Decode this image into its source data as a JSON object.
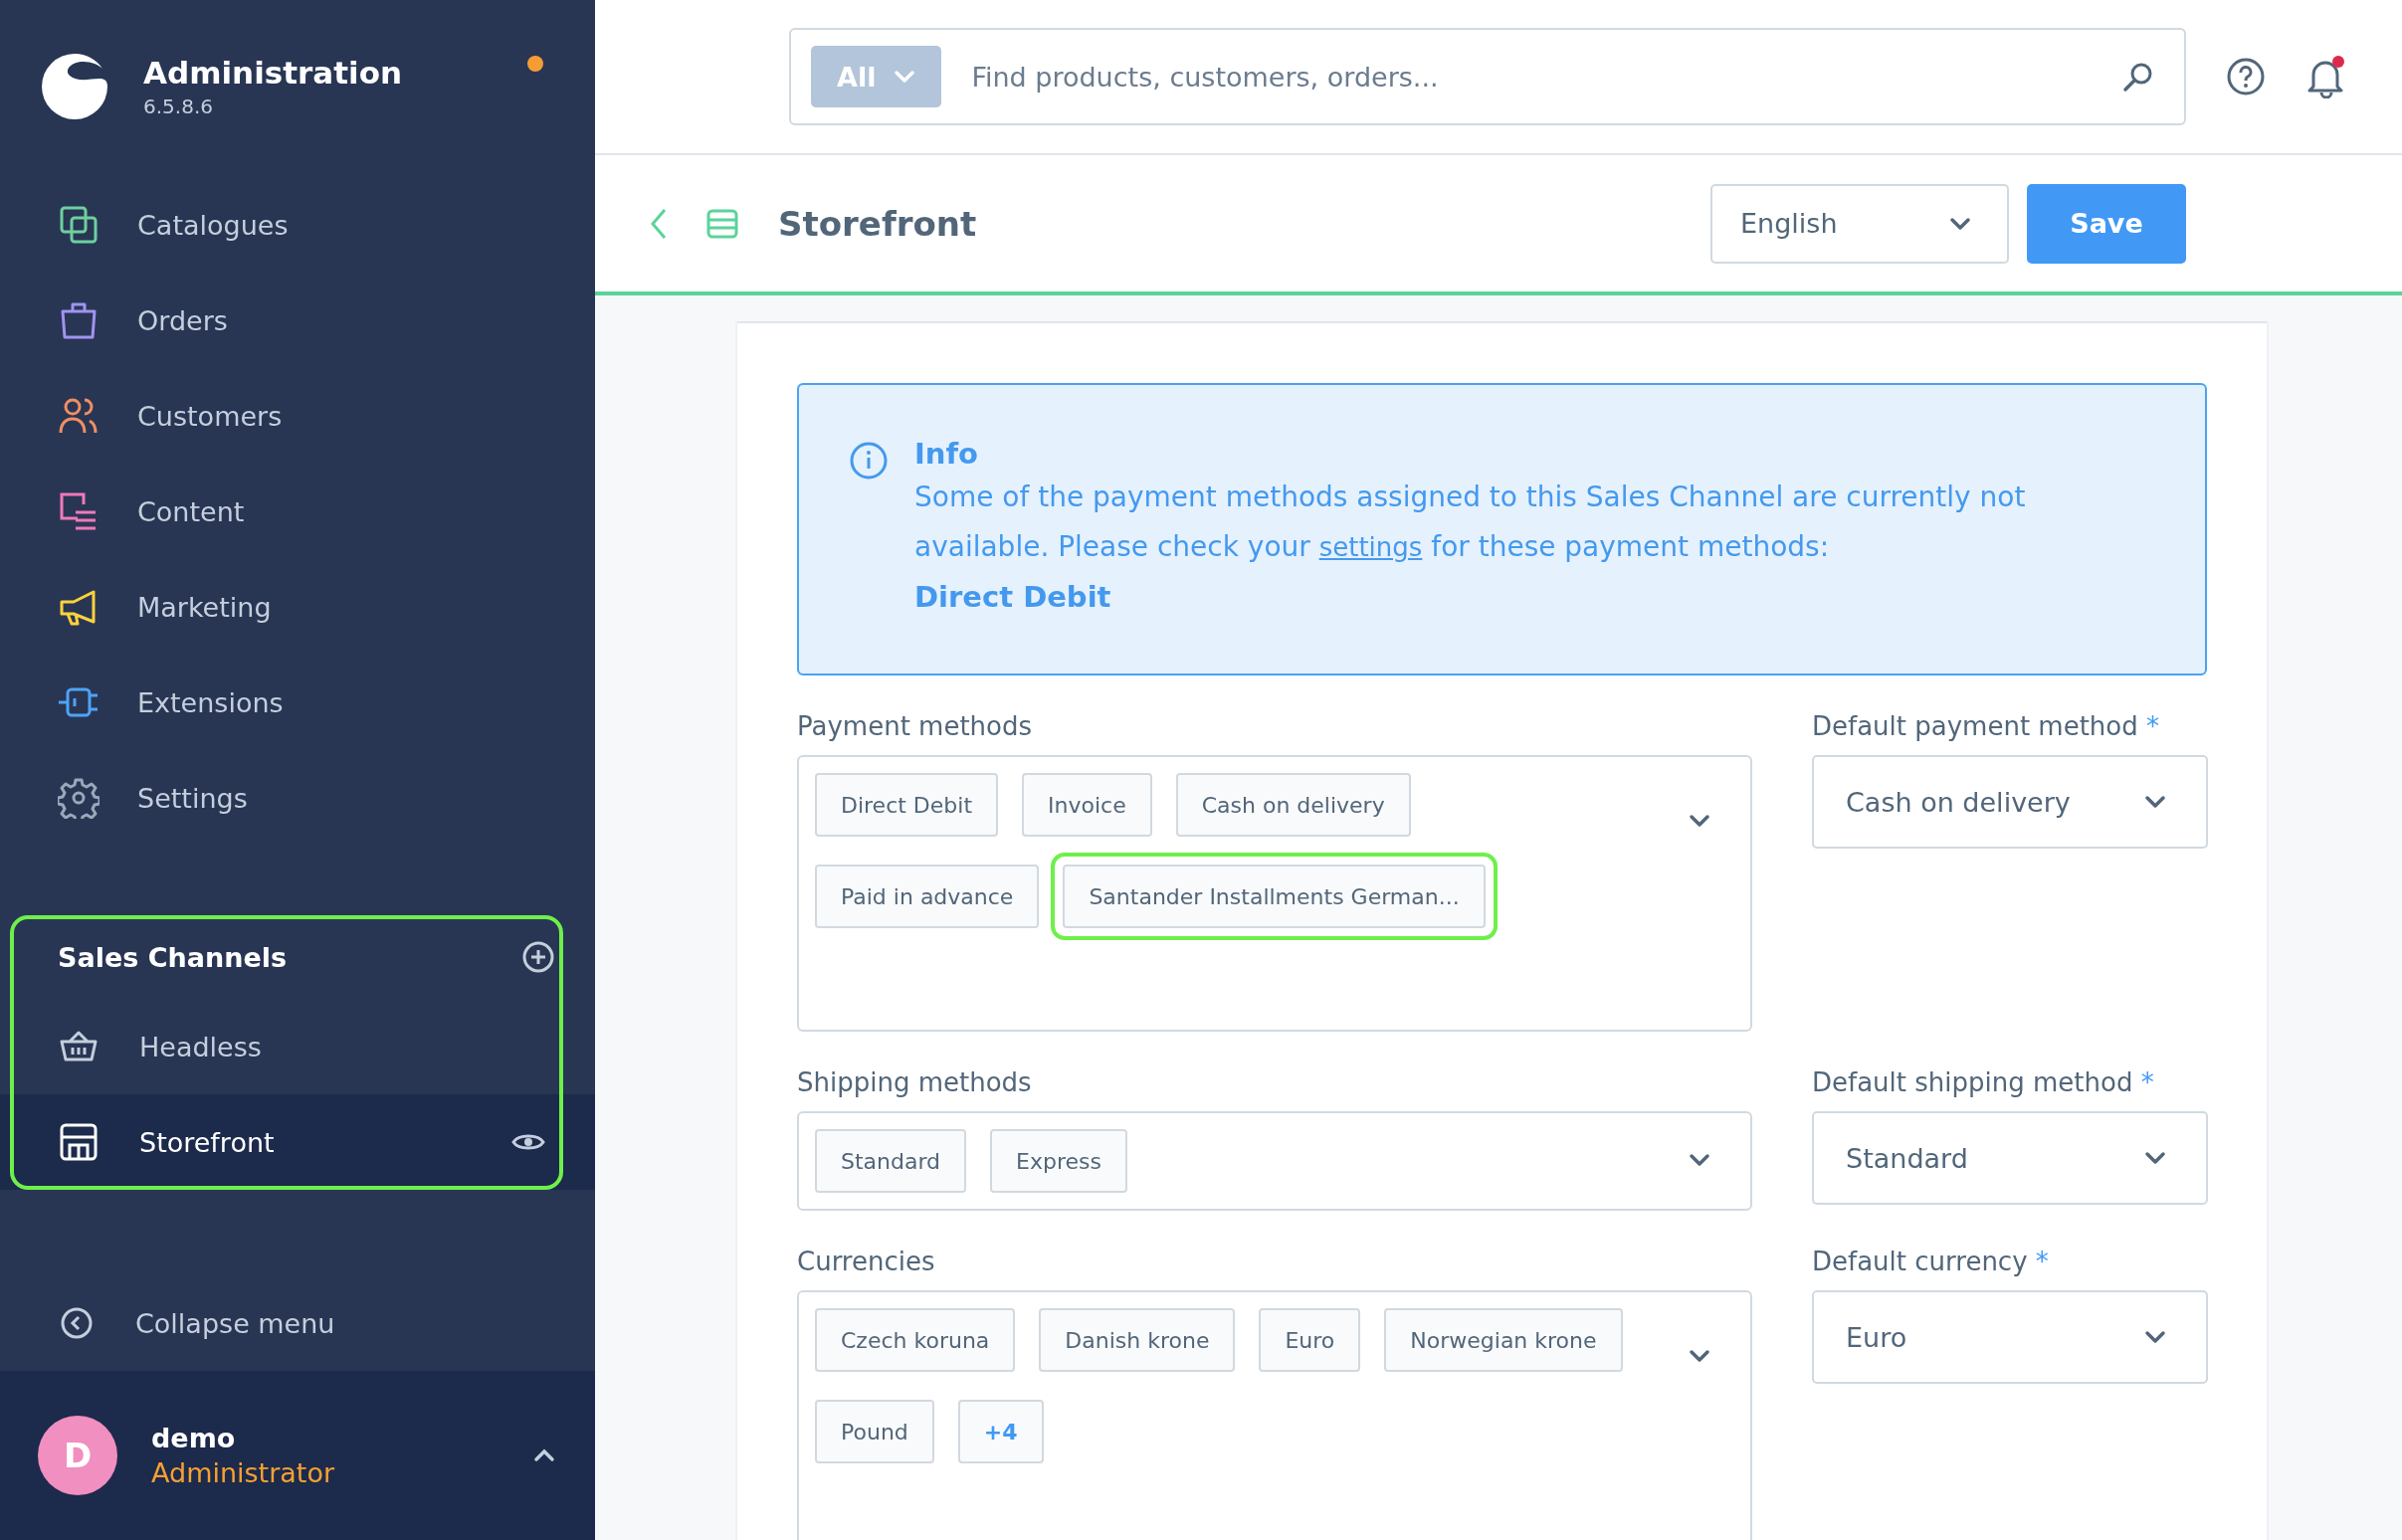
{
  "sidebar": {
    "app_name": "Administration",
    "version": "6.5.8.6",
    "nav": [
      {
        "label": "Catalogues",
        "kind": "catalogues",
        "color": "#6ed09e"
      },
      {
        "label": "Orders",
        "kind": "orders",
        "color": "#a193f0"
      },
      {
        "label": "Customers",
        "kind": "customers",
        "color": "#f08e63"
      },
      {
        "label": "Content",
        "kind": "content",
        "color": "#f07ab8"
      },
      {
        "label": "Marketing",
        "kind": "marketing",
        "color": "#fcd23c"
      },
      {
        "label": "Extensions",
        "kind": "extensions",
        "color": "#4ea3f7"
      },
      {
        "label": "Settings",
        "kind": "settings",
        "color": "#9aa8ba"
      }
    ],
    "sales_channels": {
      "title": "Sales Channels",
      "highlighted": true,
      "items": [
        {
          "label": "Headless",
          "kind": "basket",
          "selected": false
        },
        {
          "label": "Storefront",
          "kind": "store",
          "selected": true
        }
      ]
    },
    "collapse": "Collapse menu",
    "user": {
      "initial": "D",
      "name": "demo",
      "role": "Administrator"
    }
  },
  "search": {
    "scope": "All",
    "placeholder": "Find products, customers, orders..."
  },
  "page": {
    "title": "Storefront",
    "language": "English",
    "save": "Save"
  },
  "info": {
    "title": "Info",
    "text_before": "Some of the payment methods assigned to this Sales Channel are currently not available. Please check your ",
    "link": "settings",
    "text_after": " for these payment methods:",
    "methods": "Direct Debit"
  },
  "rows": [
    {
      "multi": {
        "label": "Payment methods",
        "tags": [
          {
            "label": "Direct Debit",
            "kind": "tag",
            "highlighted": false
          },
          {
            "label": "Invoice",
            "kind": "tag",
            "highlighted": false
          },
          {
            "label": "Cash on delivery",
            "kind": "tag",
            "highlighted": false
          },
          {
            "label": "Paid in advance",
            "kind": "tag",
            "highlighted": false
          },
          {
            "label": "Santander Installments German...",
            "kind": "tag",
            "highlighted": true
          }
        ]
      },
      "default": {
        "label": "Default payment method",
        "required": true,
        "required_mark": "*",
        "value": "Cash on delivery"
      }
    },
    {
      "multi": {
        "label": "Shipping methods",
        "tags": [
          {
            "label": "Standard",
            "kind": "tag",
            "highlighted": false
          },
          {
            "label": "Express",
            "kind": "tag",
            "highlighted": false
          }
        ]
      },
      "default": {
        "label": "Default shipping method",
        "required": true,
        "required_mark": "*",
        "value": "Standard"
      }
    },
    {
      "multi": {
        "label": "Currencies",
        "tags": [
          {
            "label": "Czech koruna",
            "kind": "tag",
            "highlighted": false
          },
          {
            "label": "Danish krone",
            "kind": "tag",
            "highlighted": false
          },
          {
            "label": "Euro",
            "kind": "tag",
            "highlighted": false
          },
          {
            "label": "Norwegian krone",
            "kind": "tag",
            "highlighted": false
          },
          {
            "label": "Pound",
            "kind": "tag",
            "highlighted": false
          },
          {
            "label": "+4",
            "kind": "more",
            "highlighted": false
          }
        ]
      },
      "default": {
        "label": "Default currency",
        "required": true,
        "required_mark": "*",
        "value": "Euro"
      }
    }
  ]
}
